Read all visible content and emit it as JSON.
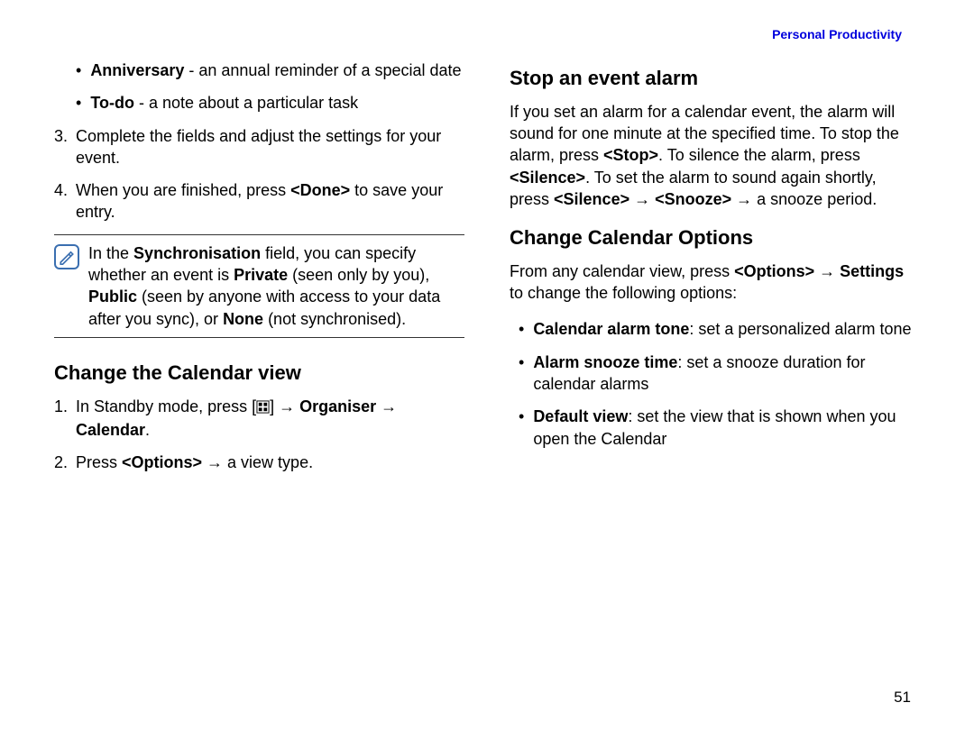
{
  "header": "Personal Productivity",
  "left": {
    "bullets": [
      {
        "bold": "Anniversary",
        "rest": " - an annual reminder of a special date"
      },
      {
        "bold": "To-do",
        "rest": " - a note about a particular task"
      }
    ],
    "steps": [
      {
        "num": "3.",
        "plain_before": "Complete the fields and adjust the settings for your event.",
        "bold": "",
        "plain_after": ""
      },
      {
        "num": "4.",
        "plain_before": "When you are finished, press ",
        "bold": "<Done>",
        "plain_after": " to save your entry."
      }
    ],
    "note": {
      "t1": "In the ",
      "b1": "Synchronisation",
      "t2": " field, you can specify whether an event is ",
      "b2": "Private",
      "t3": " (seen only by you), ",
      "b3": "Public",
      "t4": " (seen by anyone with access to your data after you sync), or ",
      "b4": "None",
      "t5": " (not synchronised)."
    },
    "h2": "Change the Calendar view",
    "view_steps": {
      "s1_num": "1.",
      "s1_a": "In Standby mode, press [",
      "s1_b": "] → ",
      "s1_bold": "Organiser → Calendar",
      "s1_c": ".",
      "s2_num": "2.",
      "s2_a": "Press ",
      "s2_bold": "<Options>",
      "s2_b": " → a view type."
    }
  },
  "right": {
    "h2a": "Stop an event alarm",
    "p1": {
      "t1": "If you set an alarm for a calendar event, the alarm will sound for one minute at the specified time. To stop the alarm, press ",
      "b1": "<Stop>",
      "t2": ". To silence the alarm, press ",
      "b2": "<Silence>",
      "t3": ". To set the alarm to sound again shortly, press ",
      "b3": "<Silence>",
      "t4": " → ",
      "b4": "<Snooze>",
      "t5": " → a snooze period."
    },
    "h2b": "Change Calendar Options",
    "p2": {
      "t1": "From any calendar view, press ",
      "b1": "<Options>",
      "t2": " → ",
      "b2": "Settings",
      "t3": " to change the following options:"
    },
    "opts": [
      {
        "bold": "Calendar alarm tone",
        "rest": ": set a personalized alarm tone"
      },
      {
        "bold": "Alarm snooze time",
        "rest": ": set a snooze duration for calendar alarms"
      },
      {
        "bold": "Default view",
        "rest": ": set the view that is shown when you open the Calendar"
      }
    ]
  },
  "page_num": "51"
}
